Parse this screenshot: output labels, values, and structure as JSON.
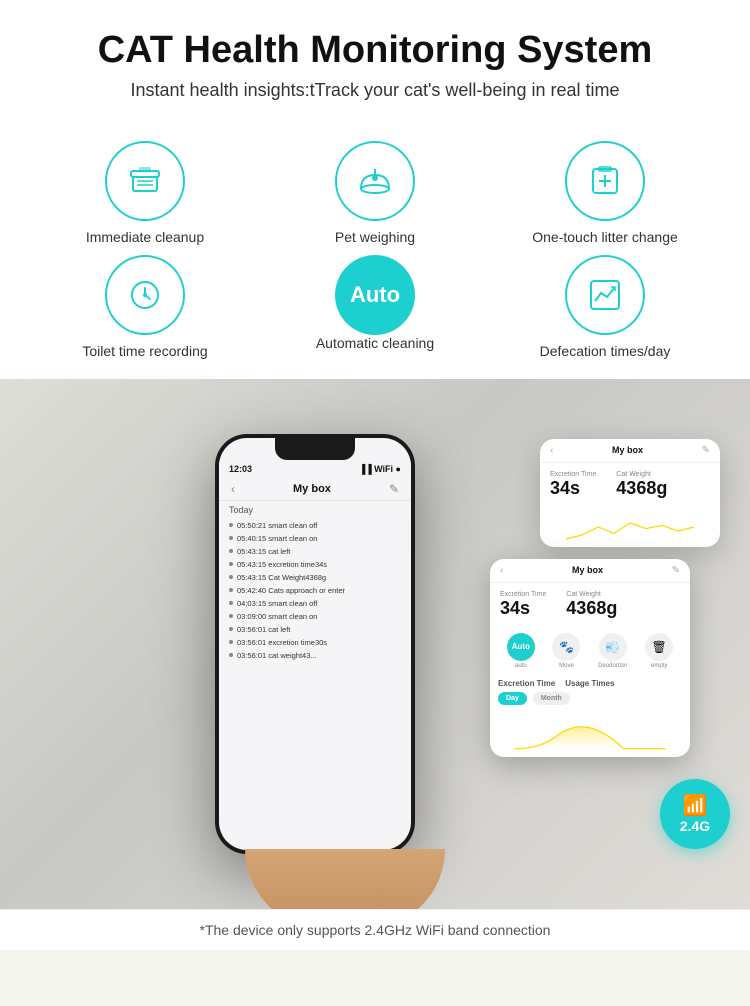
{
  "header": {
    "title": "CAT Health Monitoring System",
    "subtitle": "Instant health insights:tTrack your cat's well-being in real time"
  },
  "features": {
    "row1": [
      {
        "id": "immediate-cleanup",
        "label": "Immediate cleanup",
        "icon_type": "cleanup"
      },
      {
        "id": "pet-weighing",
        "label": "Pet weighing",
        "icon_type": "scale"
      },
      {
        "id": "one-touch-litter",
        "label": "One-touch litter change",
        "icon_type": "litter"
      }
    ],
    "row2": [
      {
        "id": "toilet-time",
        "label": "Toilet time recording",
        "icon_type": "clock"
      },
      {
        "id": "auto-cleaning",
        "label": "Automatic cleaning",
        "icon_type": "auto"
      },
      {
        "id": "defecation-times",
        "label": "Defecation times/day",
        "icon_type": "chart"
      }
    ]
  },
  "phone_main": {
    "status_time": "12:03",
    "nav_title": "My box",
    "section_label": "Today",
    "log_items": [
      "05:50:21  smart clean off",
      "05:40:15  smart clean on",
      "05:43:15  cat left",
      "05:43:15  excretion time34s",
      "05:43:15  Cat Weight4368g",
      "05:42:40  Cats approach or enter",
      "04:03:15  smart clean off",
      "03:09:00  smart clean on",
      "03:56:01  cat left",
      "03:56:01  excretion time30s",
      "03:56:01  cat weight43..."
    ]
  },
  "app_card_1": {
    "nav_title": "My box",
    "excretion_label": "Excretion Time",
    "excretion_value": "34s",
    "weight_label": "Cat Weight",
    "weight_value": "4368g"
  },
  "app_card_2": {
    "nav_title": "My box",
    "excretion_label": "Excretion Time",
    "excretion_value": "34s",
    "weight_label": "Cat Weight",
    "weight_value": "4368g",
    "tabs": {
      "auto": "Auto",
      "move": "Move",
      "deodorizer": "Deodorizer",
      "empty": "Empty"
    },
    "chart_tabs": {
      "active": "Day",
      "inactive": "Month"
    },
    "chart_section": "Excretion Time",
    "usage_section": "Usage Times"
  },
  "wifi_badge": {
    "label": "2.4G"
  },
  "footer": {
    "note": "*The device only supports 2.4GHz WiFi band connection"
  }
}
